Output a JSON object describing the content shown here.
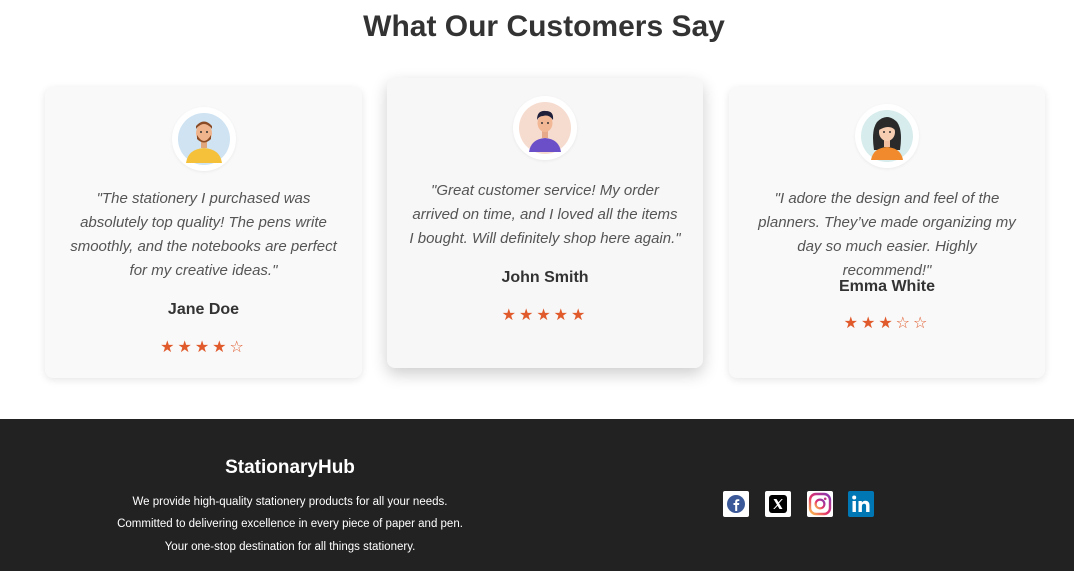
{
  "testimonials": {
    "title": "What Our Customers Say",
    "items": [
      {
        "quote": "\"The stationery I purchased was absolutely top quality! The pens write smoothly, and the notebooks are perfect for my creative ideas.\"",
        "name": "Jane Doe",
        "stars": "★★★★☆",
        "rating": 4
      },
      {
        "quote": "\"Great customer service! My order arrived on time, and I loved all the items I bought. Will definitely shop here again.\"",
        "name": "John Smith",
        "stars": "★★★★★",
        "rating": 5
      },
      {
        "quote": "\"I adore the design and feel of the planners. They’ve made organizing my day so much easier. Highly recommend!\"",
        "name": "Emma White",
        "stars": "★★★☆☆",
        "rating": 3
      }
    ]
  },
  "footer": {
    "brand": "StationaryHub",
    "lines": [
      "We provide high-quality stationery products for all your needs.",
      "Committed to delivering excellence in every piece of paper and pen.",
      "Your one-stop destination for all things stationery."
    ],
    "social": [
      {
        "icon": "facebook-icon",
        "color": "#3b5998"
      },
      {
        "icon": "x-icon",
        "color": "#000000"
      },
      {
        "icon": "instagram-icon",
        "color": "#d6249f"
      },
      {
        "icon": "linkedin-icon",
        "color": "#0077b5"
      }
    ]
  },
  "colors": {
    "star": "#e05a2b",
    "footer_bg": "#222222",
    "card_bg": "#f9f9f9"
  }
}
